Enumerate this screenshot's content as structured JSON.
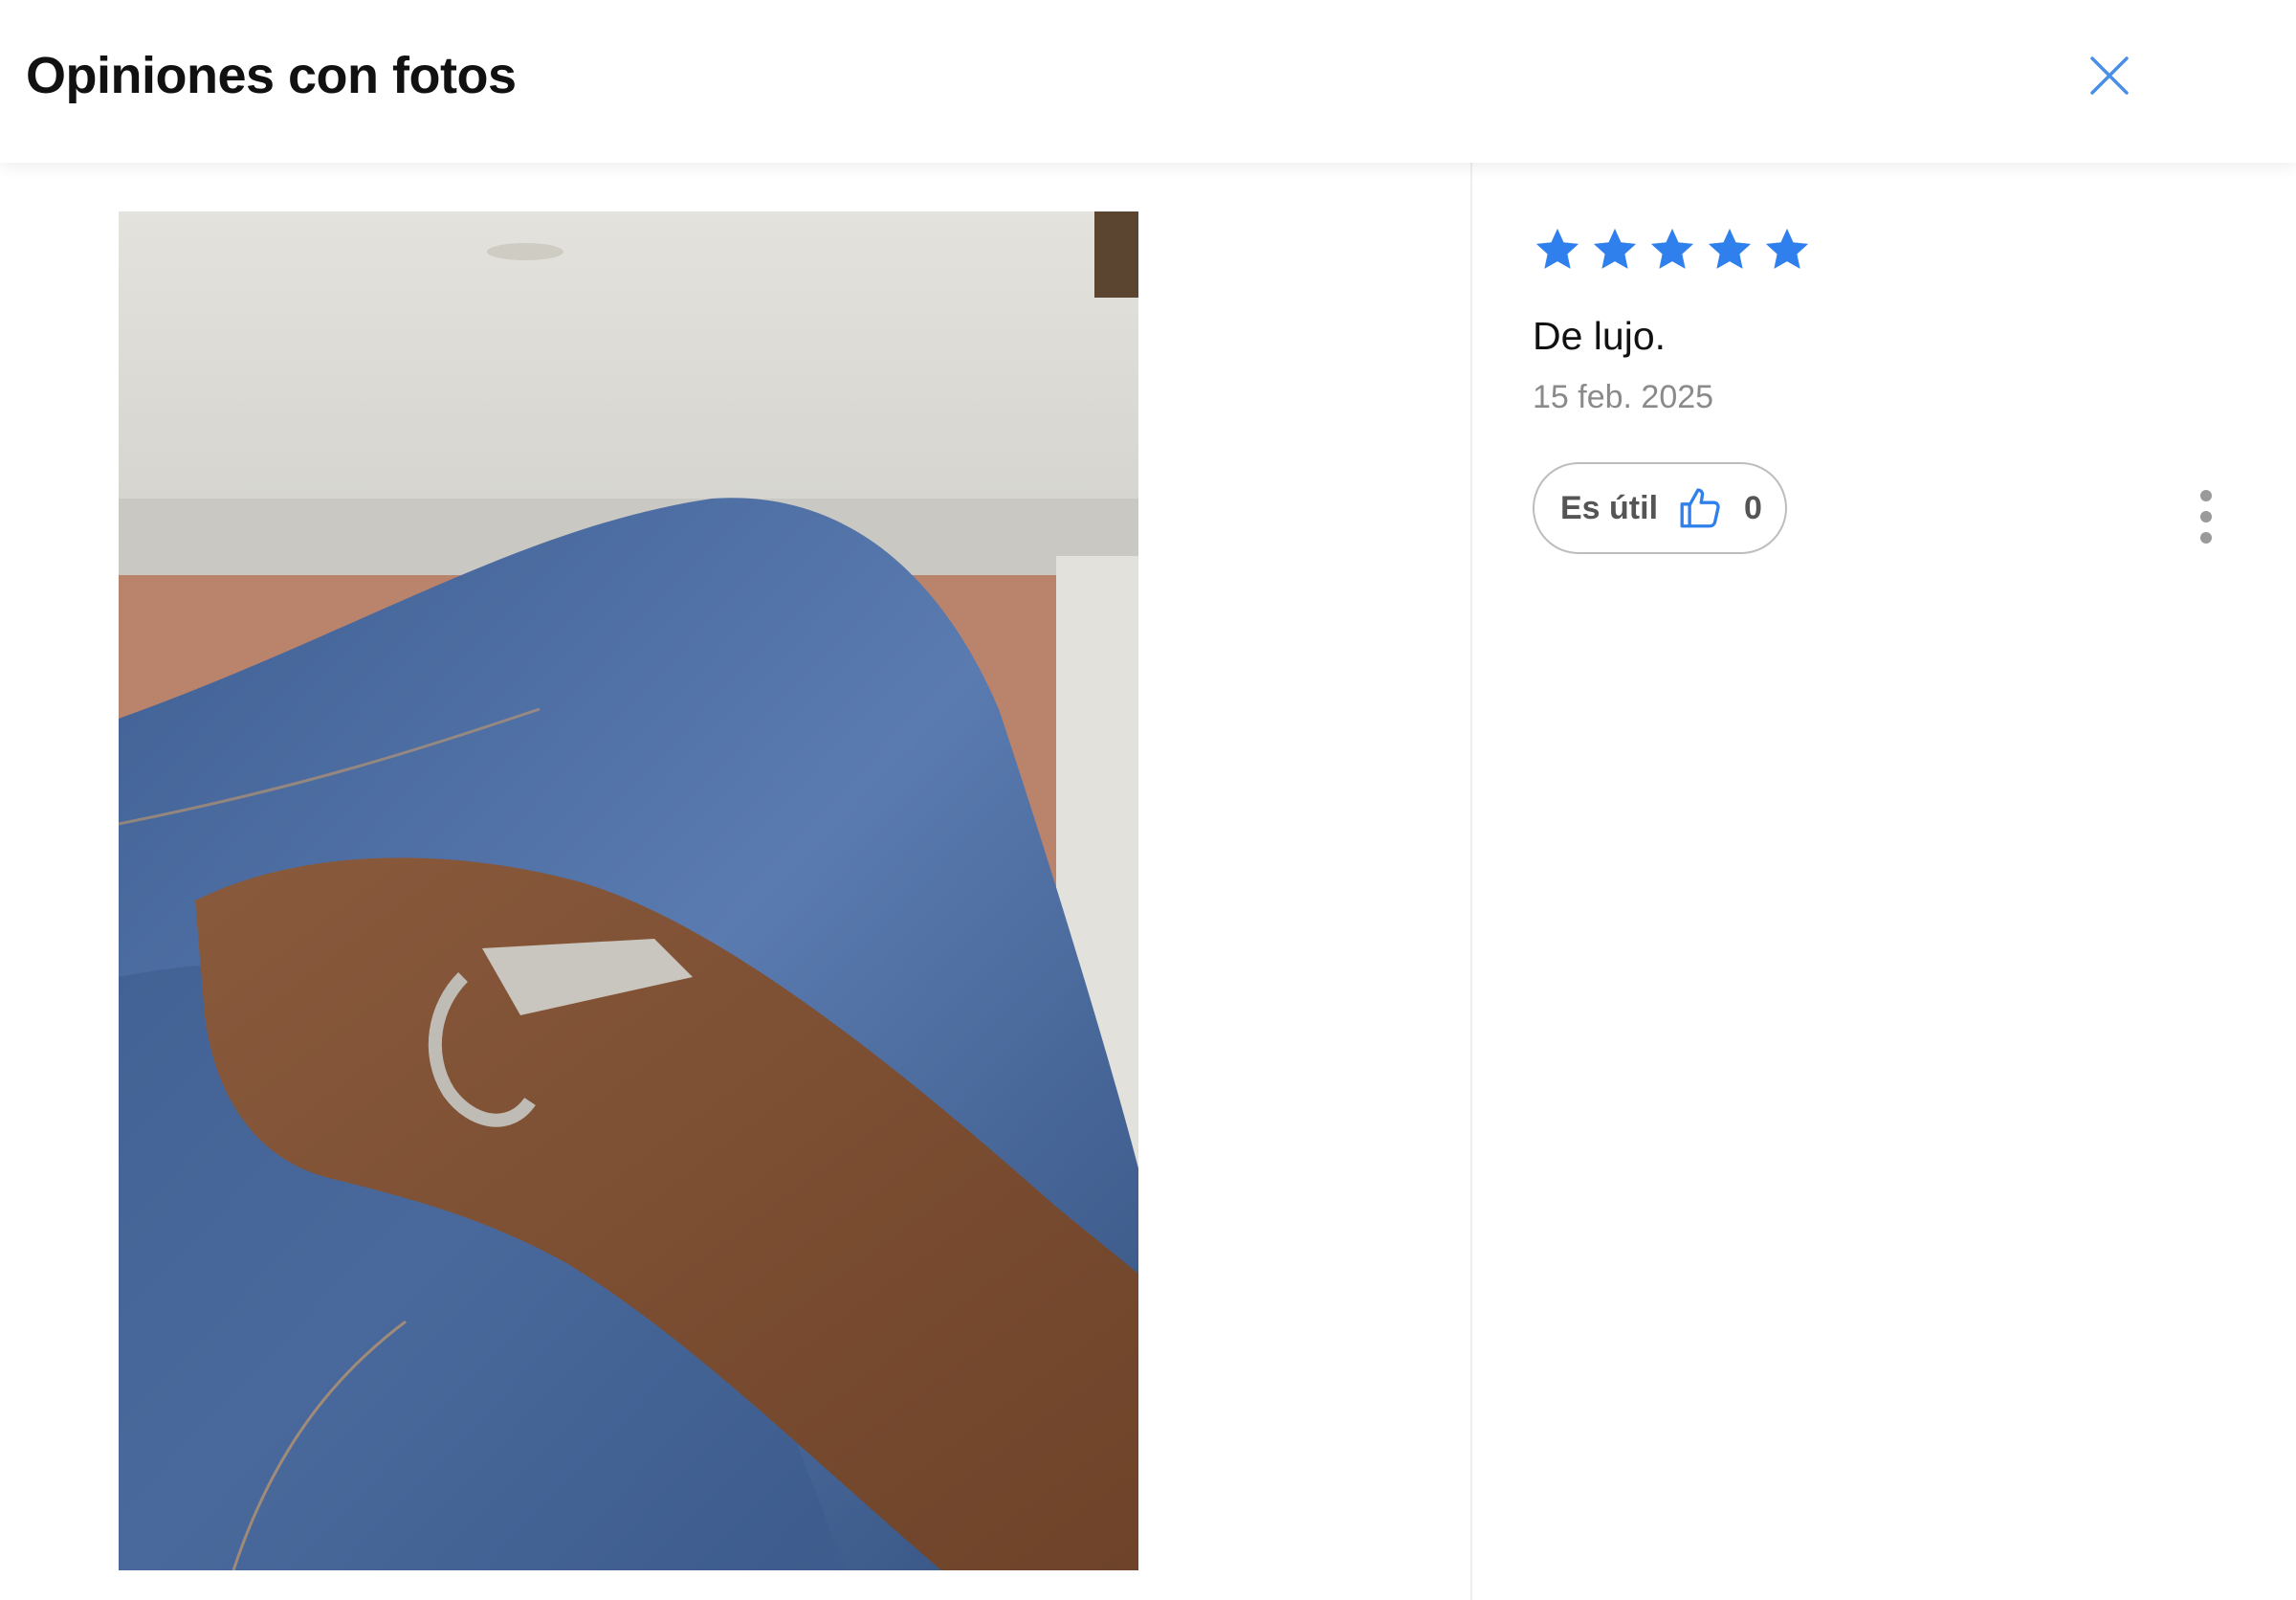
{
  "header": {
    "title": "Opiniones con fotos",
    "close_icon": "close-icon"
  },
  "photo": {
    "description_icon": "review-photo"
  },
  "review": {
    "rating": 5,
    "rating_max": 5,
    "star_color": "#2f80ed",
    "title": "De lujo.",
    "date": "15 feb. 2025",
    "helpful": {
      "label": "Es útil",
      "icon": "thumbs-up-icon",
      "count": "0"
    },
    "more_icon": "more-vertical-icon"
  },
  "colors": {
    "accent": "#2f80ed",
    "muted_text": "#8a8a8a",
    "border": "#bdbdbd"
  }
}
